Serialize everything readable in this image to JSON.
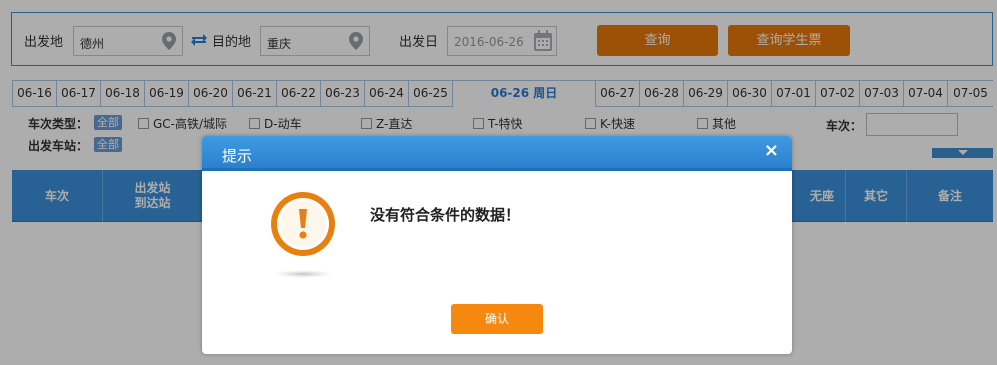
{
  "search": {
    "from_label": "出发地",
    "from_value": "德州",
    "to_label": "目的地",
    "to_value": "重庆",
    "date_label": "出发日",
    "date_value": "2016-06-26",
    "query_button": "查询",
    "student_button": "查询学生票"
  },
  "date_tabs": [
    "06-16",
    "06-17",
    "06-18",
    "06-19",
    "06-20",
    "06-21",
    "06-22",
    "06-23",
    "06-24",
    "06-25",
    "06-26 周日",
    "06-27",
    "06-28",
    "06-29",
    "06-30",
    "07-01",
    "07-02",
    "07-03",
    "07-04",
    "07-05"
  ],
  "active_date": "06-26 周日",
  "filters": {
    "type_label": "车次类型：",
    "all_tag": "全部",
    "types": [
      "GC-高铁/城际",
      "D-动车",
      "Z-直达",
      "T-特快",
      "K-快速",
      "其他"
    ],
    "train_label": "车次：",
    "station_label": "出发车站：",
    "station_all_tag": "全部"
  },
  "table_headers": {
    "train": "车次",
    "station_top": "出发站",
    "station_bottom": "到达站",
    "none_seat": "无座",
    "other": "其它",
    "remark": "备注"
  },
  "dialog": {
    "title": "提示",
    "close": "×",
    "message": "没有符合条件的数据！",
    "ok": "确认"
  },
  "colors": {
    "primary_blue": "#3b8fd9",
    "orange": "#e7780a",
    "warning_orange": "#e8800f"
  }
}
